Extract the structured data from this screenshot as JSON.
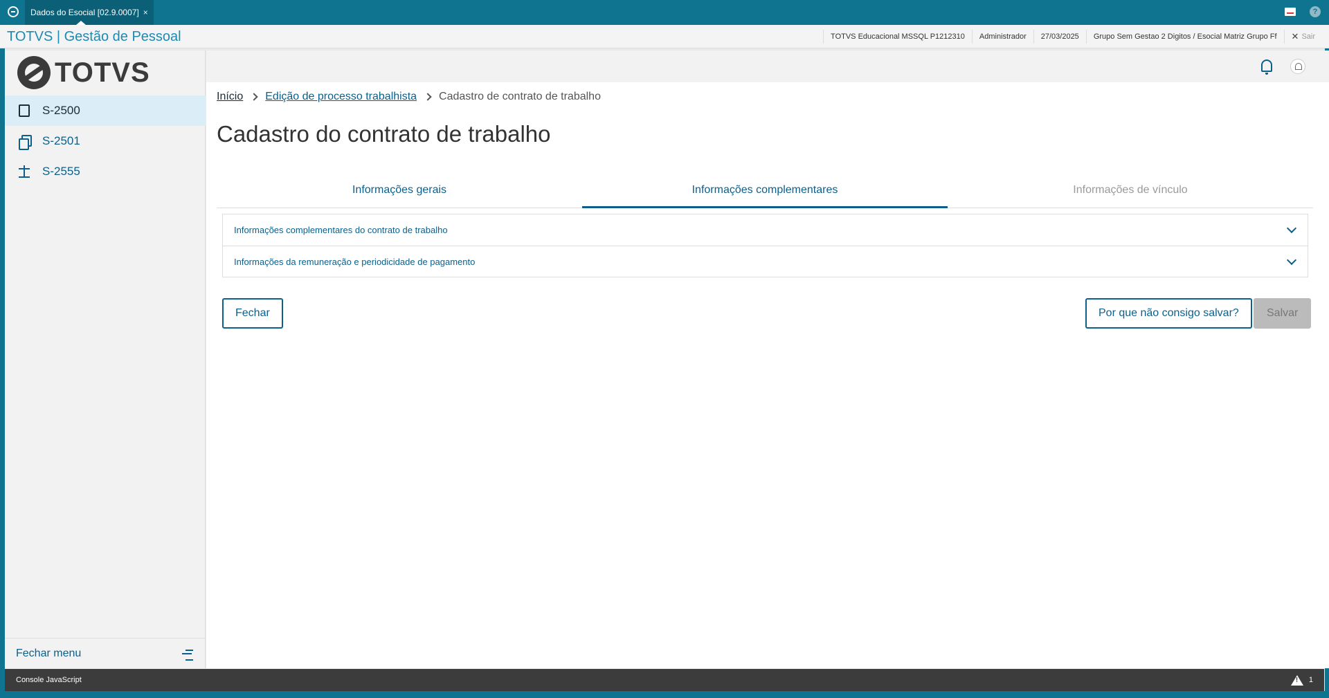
{
  "window": {
    "tab_title": "Dados do Esocial [02.9.0007]",
    "tab_close": "×"
  },
  "header": {
    "brand": "TOTVS | Gestão de Pessoal",
    "environment": "TOTVS Educacional MSSQL P1212310",
    "user": "Administrador",
    "date": "27/03/2025",
    "company": "Grupo Sem Gestao 2 Digitos / Esocial Matriz Grupo Ff",
    "logout_icon": "✕",
    "logout_label": "Sair"
  },
  "sidebar": {
    "logo_text": "TOTVS",
    "items": [
      {
        "label": "S-2500",
        "icon": "document-icon",
        "active": true
      },
      {
        "label": "S-2501",
        "icon": "copy-icon",
        "active": false
      },
      {
        "label": "S-2555",
        "icon": "scale-icon",
        "active": false
      }
    ],
    "footer_label": "Fechar menu"
  },
  "breadcrumb": {
    "home": "Início",
    "parent": "Edição de processo trabalhista",
    "current": "Cadastro de contrato de trabalho"
  },
  "page_title": "Cadastro do contrato de trabalho",
  "tabs": [
    {
      "label": "Informações gerais",
      "state": "normal"
    },
    {
      "label": "Informações complementares",
      "state": "active"
    },
    {
      "label": "Informações de vínculo",
      "state": "disabled"
    }
  ],
  "accordion": [
    {
      "label": "Informações complementares do contrato de trabalho"
    },
    {
      "label": "Informações da remuneração e periodicidade de pagamento"
    }
  ],
  "buttons": {
    "close": "Fechar",
    "why": "Por que não consigo salvar?",
    "save": "Salvar"
  },
  "console": {
    "label": "Console JavaScript",
    "warning_count": "1"
  },
  "colors": {
    "primary": "#0b5f8a",
    "topbar": "#0e7490",
    "brand": "#1a8bb3"
  }
}
